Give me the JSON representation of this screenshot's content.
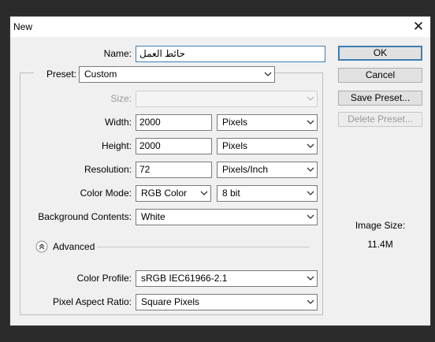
{
  "window": {
    "title": "New",
    "close_glyph": "✕"
  },
  "name": {
    "label": "Name:",
    "value": "حائط العمل"
  },
  "preset": {
    "label": "Preset:",
    "value": "Custom"
  },
  "size": {
    "label": "Size:",
    "value": ""
  },
  "width": {
    "label": "Width:",
    "value": "2000",
    "unit": "Pixels"
  },
  "height": {
    "label": "Height:",
    "value": "2000",
    "unit": "Pixels"
  },
  "resolution": {
    "label": "Resolution:",
    "value": "72",
    "unit": "Pixels/Inch"
  },
  "color_mode": {
    "label": "Color Mode:",
    "value": "RGB Color",
    "depth": "8 bit"
  },
  "background": {
    "label": "Background Contents:",
    "value": "White"
  },
  "advanced": {
    "label": "Advanced",
    "icon": "collapse-up-icon"
  },
  "color_profile": {
    "label": "Color Profile:",
    "value": "sRGB IEC61966-2.1"
  },
  "pixel_aspect": {
    "label": "Pixel Aspect Ratio:",
    "value": "Square Pixels"
  },
  "buttons": {
    "ok": "OK",
    "cancel": "Cancel",
    "save_preset": "Save Preset...",
    "delete_preset": "Delete Preset..."
  },
  "image_size": {
    "label": "Image Size:",
    "value": "11.4M"
  }
}
